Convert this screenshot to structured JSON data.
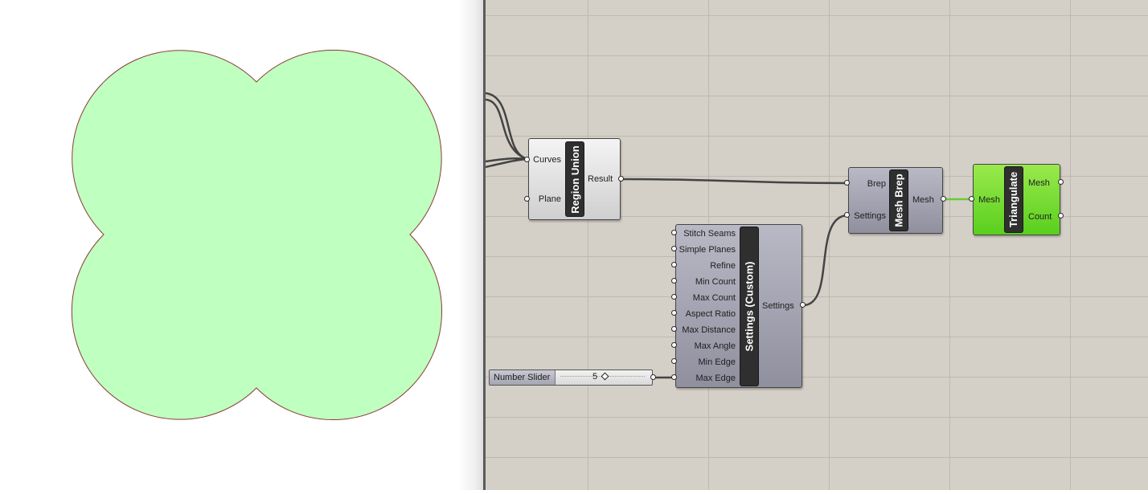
{
  "components": {
    "region_union": {
      "title": "Region Union",
      "inputs": [
        "Curves",
        "Plane"
      ],
      "outputs": [
        "Result"
      ]
    },
    "mesh_brep": {
      "title": "Mesh Brep",
      "inputs": [
        "Brep",
        "Settings"
      ],
      "outputs": [
        "Mesh"
      ]
    },
    "triangulate": {
      "title": "Triangulate",
      "inputs": [
        "Mesh"
      ],
      "outputs": [
        "Mesh",
        "Count"
      ]
    },
    "settings_custom": {
      "title": "Settings (Custom)",
      "inputs": [
        "Stitch Seams",
        "Simple Planes",
        "Refine",
        "Min Count",
        "Max Count",
        "Aspect Ratio",
        "Max Distance",
        "Max Angle",
        "Min Edge",
        "Max Edge"
      ],
      "outputs": [
        "Settings"
      ]
    },
    "number_slider": {
      "label": "Number Slider",
      "value": "5"
    }
  },
  "colors": {
    "region_fill": "#bfffbf",
    "region_outline": "#8b3a3a",
    "canvas_bg": "#d4d0c8",
    "triangulate_accent": "#66d22a",
    "wire_default": "#444444",
    "wire_green": "#6ac93a"
  }
}
